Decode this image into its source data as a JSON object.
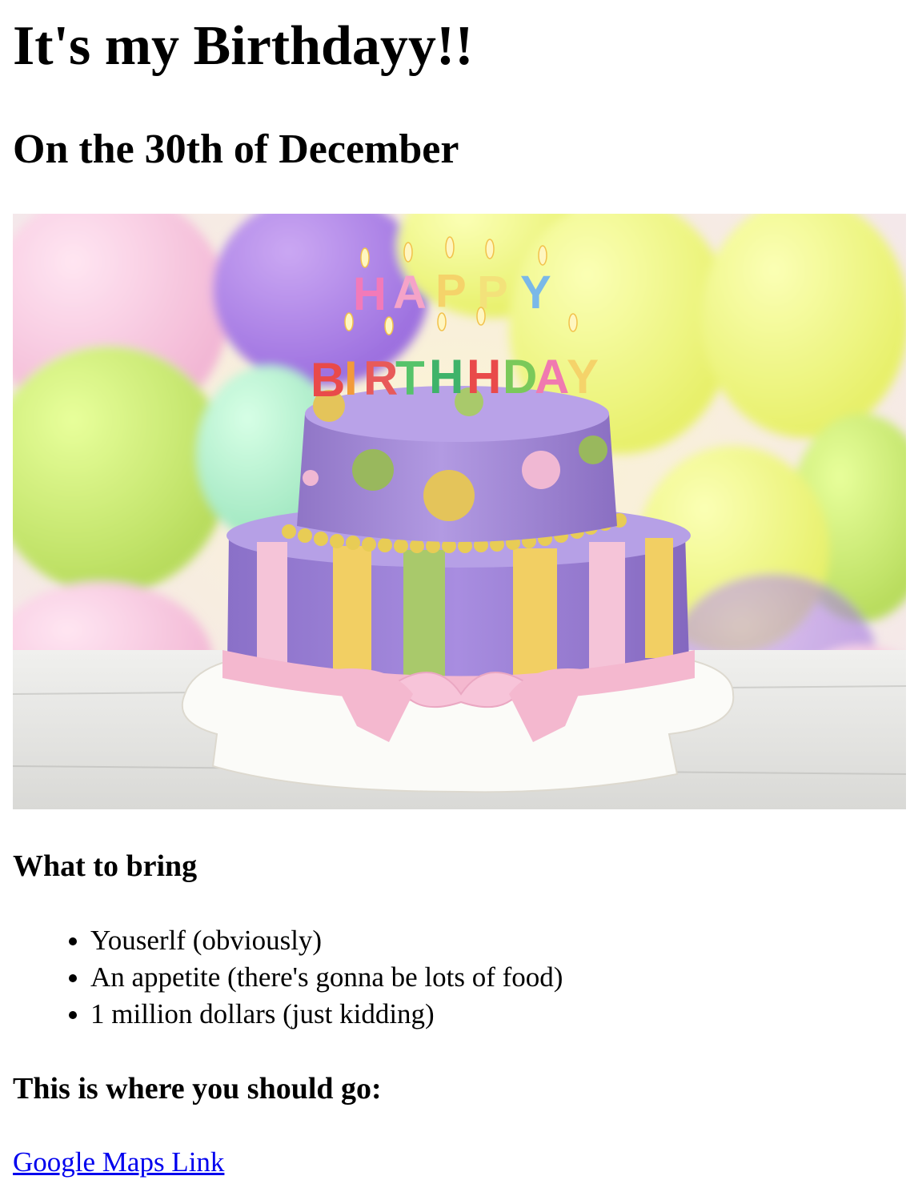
{
  "page": {
    "title": "It's my Birthdayy!!",
    "subtitle": "On the 30th of December"
  },
  "hero_image": {
    "icon": "birthday-cake-image",
    "cake_letters_top": [
      "H",
      "A",
      "P",
      "P",
      "Y"
    ],
    "cake_letters_bottom": [
      "B",
      "I",
      "R",
      "T",
      "H",
      "D",
      "A",
      "Y"
    ]
  },
  "bring": {
    "heading": "What to bring",
    "items": [
      "Youserlf (obviously)",
      "An appetite (there's gonna be lots of food)",
      "1 million dollars (just kidding)"
    ]
  },
  "location": {
    "heading": "This is where you should go:",
    "link_text": "Google Maps Link"
  },
  "colors": {
    "link": "#0000ee",
    "cake_purple": "#9b7fd0",
    "ribbon_pink": "#f4b8cf",
    "stripe_yellow": "#f2cf63",
    "stripe_green": "#a9c96b"
  }
}
